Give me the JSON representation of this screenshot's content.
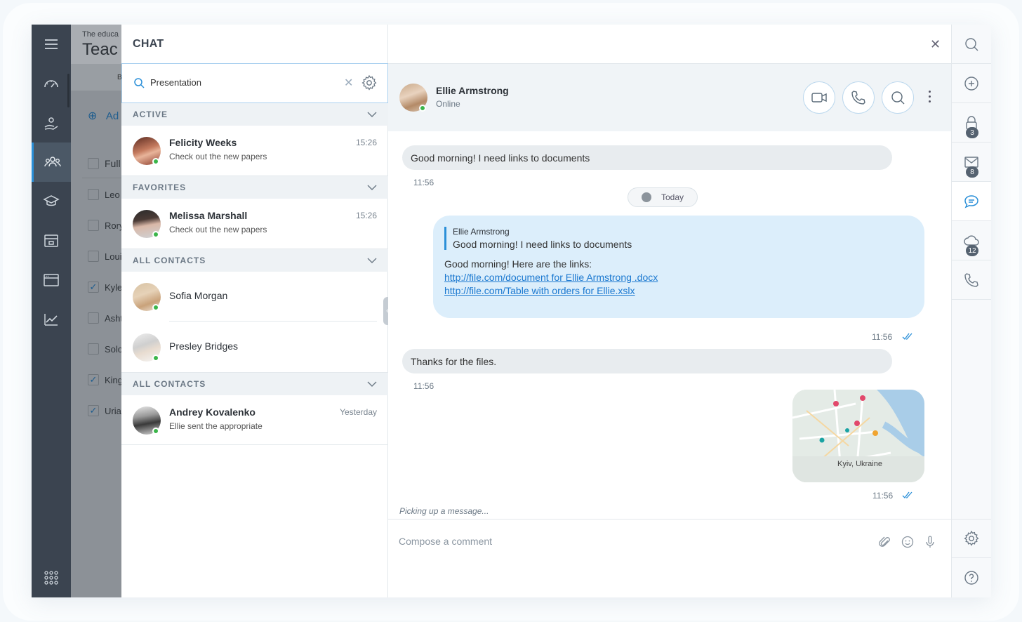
{
  "background_app": {
    "subtitle": "The educa",
    "title": "Teac",
    "tab_letter": "B",
    "add_label": "Ad",
    "rows": [
      {
        "label": "Full",
        "checked": false
      },
      {
        "label": "Leo",
        "checked": false
      },
      {
        "label": "Rory",
        "checked": false
      },
      {
        "label": "Loui",
        "checked": false
      },
      {
        "label": "Kyle",
        "checked": true
      },
      {
        "label": "Asht",
        "checked": false
      },
      {
        "label": "Solo",
        "checked": false
      },
      {
        "label": "King",
        "checked": true
      },
      {
        "label": "Uriah",
        "checked": true
      }
    ]
  },
  "chat": {
    "title": "CHAT",
    "search_value": "Presentation",
    "sections": {
      "active": "ACTIVE",
      "favorites": "FAVORITES",
      "all_contacts_1": "ALL CONTACTS",
      "all_contacts_2": "ALL CONTACTS"
    },
    "active_contact": {
      "name": "Felicity Weeks",
      "message": "Check out the new papers",
      "time": "15:26"
    },
    "favorite_contact": {
      "name": "Melissa Marshall",
      "message": "Check out the new papers",
      "time": "15:26"
    },
    "contacts": [
      {
        "name": "Sofia Morgan"
      },
      {
        "name": "Presley Bridges"
      }
    ],
    "other_contact": {
      "name": "Andrey Kovalenko",
      "message": "Ellie sent the appropriate",
      "time": "Yesterday"
    }
  },
  "conversation": {
    "name": "Ellie Armstrong",
    "status": "Online",
    "date_chip": "Today",
    "messages": {
      "m1": {
        "text": "Good morning! I need links to documents",
        "time": "11:56"
      },
      "m2": {
        "quote_author": "Ellie Armstrong",
        "quote_text": "Good morning! I need links to documents",
        "text": "Good morning! Here are the links:",
        "link1": "http://file.com/document for Ellie Armstrong .docx",
        "link2": "http://file.com/Table with orders for Ellie.xslx",
        "time": "11:56"
      },
      "m3": {
        "text": "Thanks for the files.",
        "time": "11:56"
      },
      "m4": {
        "map_label": "Kyiv, Ukraine",
        "time": "11:56"
      }
    },
    "typing": "Picking up a message...",
    "compose_placeholder": "Compose a comment"
  },
  "right_rail": {
    "badges": {
      "lock": "3",
      "mail": "8",
      "cloud": "12"
    }
  },
  "colors": {
    "rail": "#3b4450",
    "accent": "#2a8fd8",
    "online": "#3bb54a",
    "bubble_out": "#dceefb",
    "bubble_in": "#e8ecef"
  }
}
